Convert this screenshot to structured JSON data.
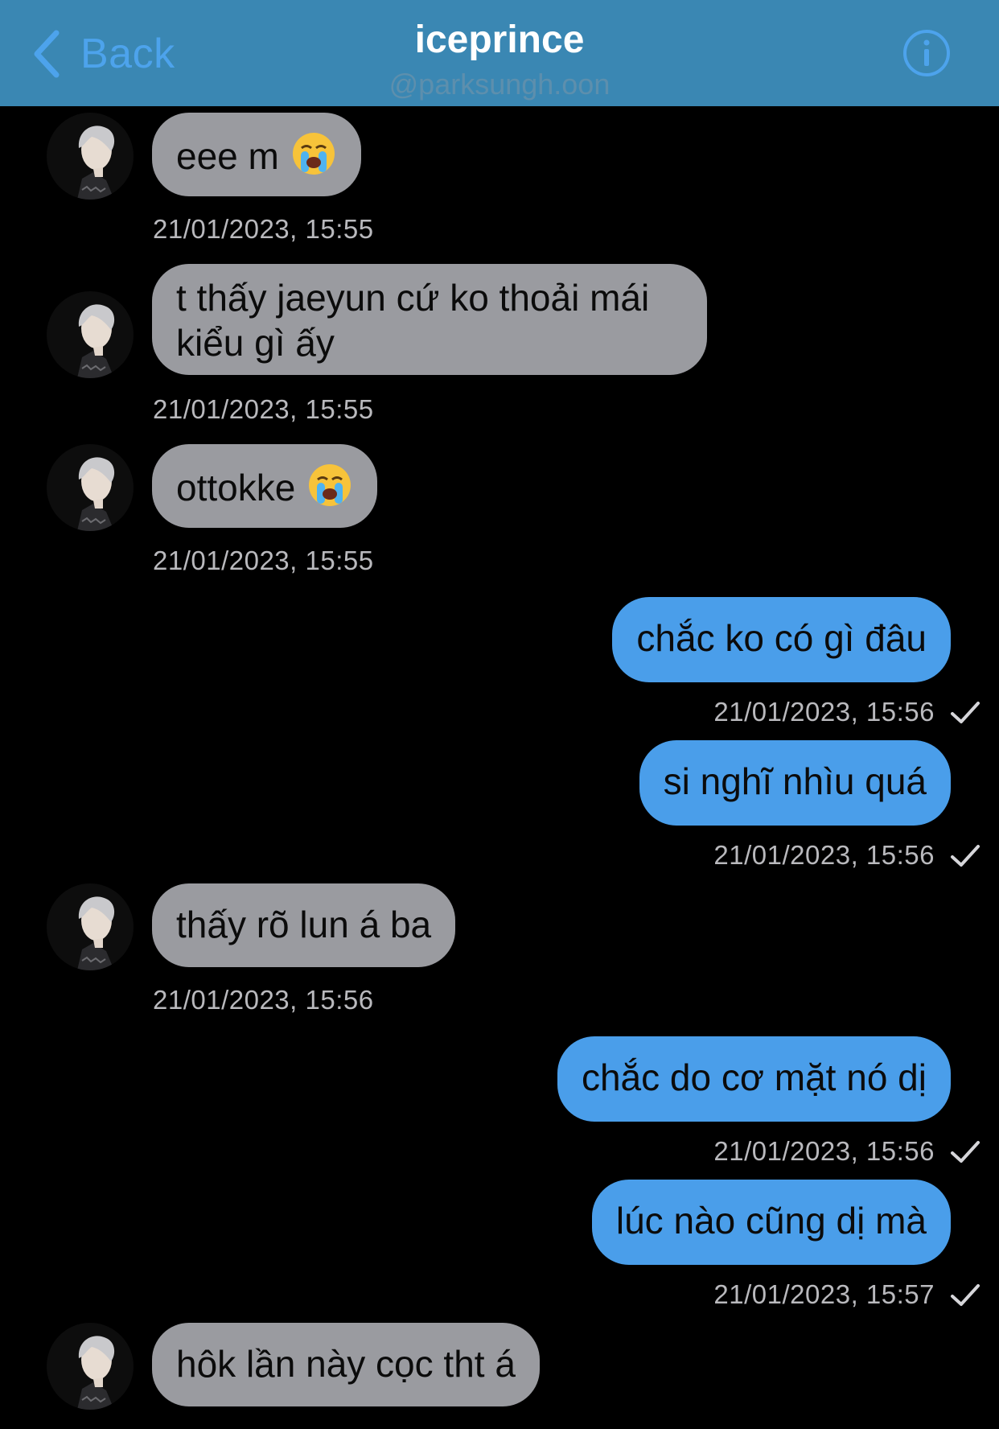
{
  "header": {
    "back_label": "Back",
    "title": "iceprince",
    "subtitle": "@parksungh.oon",
    "back_icon": "chevron-left-icon",
    "info_icon": "info-icon"
  },
  "colors": {
    "header_bg": "#3a87b3",
    "accent": "#4da3ec",
    "incoming_bubble": "#9a9ba0",
    "outgoing_bubble": "#4a9eea",
    "background": "#000000",
    "timestamp": "#b9b9bd"
  },
  "messages": [
    {
      "direction": "incoming",
      "text": "eee m",
      "emoji": "loudly-crying-face-icon",
      "timestamp": "21/01/2023, 15:55"
    },
    {
      "direction": "incoming",
      "text": "t thấy jaeyun cứ ko thoải mái kiểu gì ấy",
      "timestamp": "21/01/2023, 15:55"
    },
    {
      "direction": "incoming",
      "text": "ottokke",
      "emoji": "loudly-crying-face-icon",
      "timestamp": "21/01/2023, 15:55"
    },
    {
      "direction": "outgoing",
      "text": "chắc ko có gì đâu",
      "timestamp": "21/01/2023, 15:56",
      "status_icon": "checkmark-icon"
    },
    {
      "direction": "outgoing",
      "text": "si nghĩ nhìu quá",
      "timestamp": "21/01/2023, 15:56",
      "status_icon": "checkmark-icon"
    },
    {
      "direction": "incoming",
      "text": "thấy rõ lun á ba",
      "timestamp": "21/01/2023, 15:56"
    },
    {
      "direction": "outgoing",
      "text": "chắc do cơ mặt nó dị",
      "timestamp": "21/01/2023, 15:56",
      "status_icon": "checkmark-icon"
    },
    {
      "direction": "outgoing",
      "text": "lúc nào cũng dị mà",
      "timestamp": "21/01/2023, 15:57",
      "status_icon": "checkmark-icon"
    },
    {
      "direction": "incoming",
      "text": "hôk lần này cọc tht á"
    }
  ]
}
